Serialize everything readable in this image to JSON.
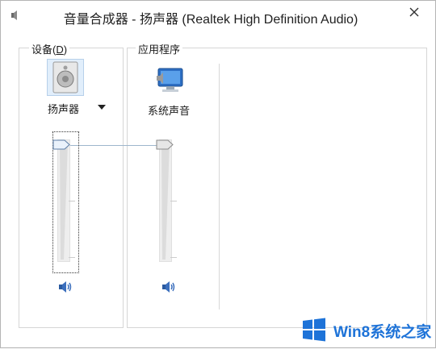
{
  "window": {
    "title": "音量合成器 - 扬声器 (Realtek High Definition Audio)",
    "app_icon": "speaker-icon",
    "close_icon": "close-icon"
  },
  "device_group": {
    "label_prefix": "设备(",
    "label_accel": "D",
    "label_suffix": ")",
    "device_name": "扬声器",
    "device_icon": "speaker-device-icon",
    "volume": 1.0,
    "mute_icon": "volume-icon"
  },
  "apps_group": {
    "label": "应用程序",
    "apps": [
      {
        "name": "系统声音",
        "icon": "system-sounds-icon",
        "volume": 1.0,
        "mute_icon": "volume-icon"
      }
    ]
  },
  "watermark": {
    "text": "Win8系统之家",
    "logo": "windows-logo"
  },
  "colors": {
    "accent": "#1e73d8",
    "tile_highlight": "#e1eefb",
    "slider_track": "#eeeeee"
  }
}
